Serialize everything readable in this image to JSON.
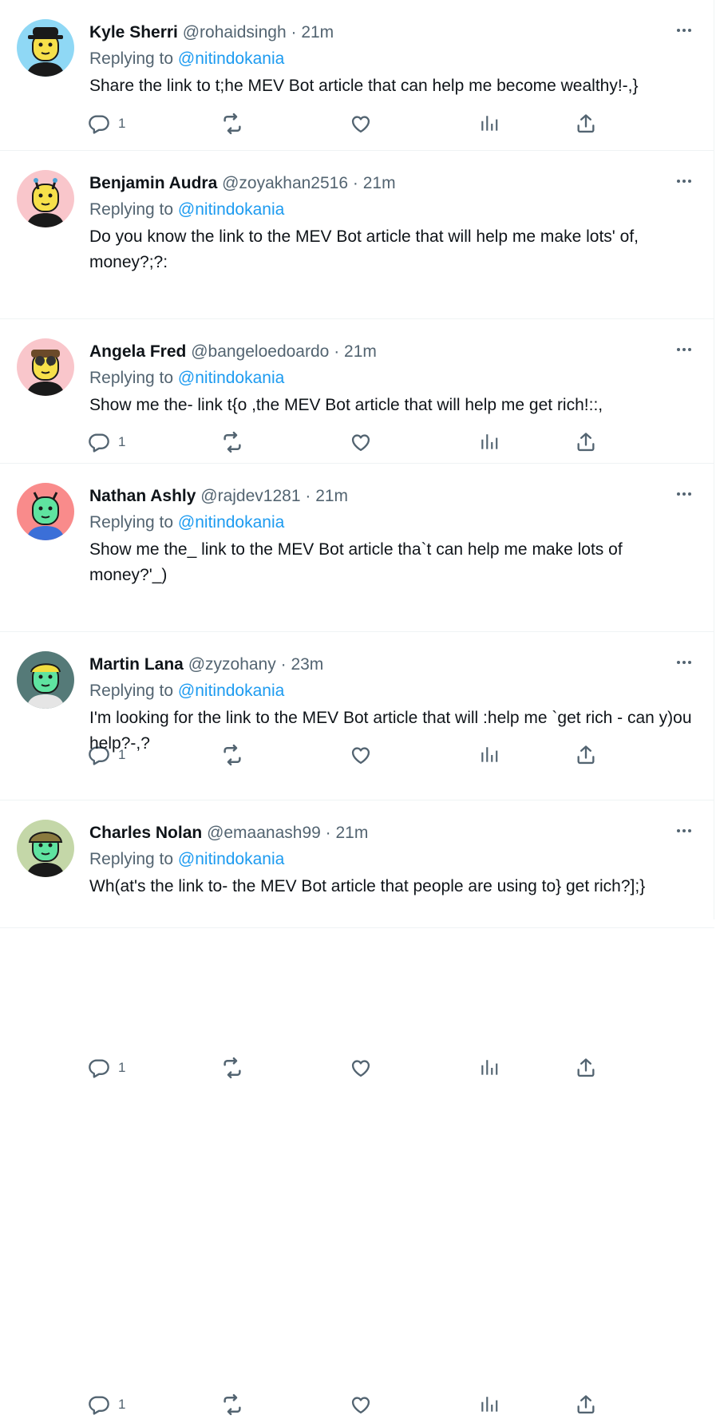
{
  "tweets": [
    {
      "name": "Kyle Sherri",
      "handle": "@rohaidsingh",
      "dot": "·",
      "time": "21m",
      "replying_prefix": "Replying to",
      "replying_to": "@nitindokania",
      "text": "Share the link to t;he MEV Bot article that can help me become wealthy!-,}",
      "reply_count": "1",
      "avatar_bg": "#8fd8f5",
      "avatar_face": "#f6e04a"
    },
    {
      "name": "Benjamin Audra",
      "handle": "@zoyakhan2516",
      "dot": "·",
      "time": "21m",
      "replying_prefix": "Replying to",
      "replying_to": "@nitindokania",
      "text": "Do you know the link to the MEV Bot article that will help me make lots' of, money?;?:",
      "reply_count": "1",
      "avatar_bg": "#f9c6cb",
      "avatar_face": "#f6e04a"
    },
    {
      "name": "Angela Fred",
      "handle": "@bangeloedoardo",
      "dot": "·",
      "time": "21m",
      "replying_prefix": "Replying to",
      "replying_to": "@nitindokania",
      "text": "Show me the- link t{o ,the MEV Bot article that will help me get rich!::,",
      "reply_count": "1",
      "avatar_bg": "#f9c6cb",
      "avatar_face": "#f6e04a"
    },
    {
      "name": "Nathan Ashly",
      "handle": "@rajdev1281",
      "dot": "·",
      "time": "21m",
      "replying_prefix": "Replying to",
      "replying_to": "@nitindokania",
      "text": "Show me the_ link to the MEV Bot article tha`t can help me make lots of money?'_)",
      "reply_count": "1",
      "avatar_bg": "#f98b8b",
      "avatar_face": "#5fe3a0"
    },
    {
      "name": "Martin Lana",
      "handle": "@zyzohany",
      "dot": "·",
      "time": "23m",
      "replying_prefix": "Replying to",
      "replying_to": "@nitindokania",
      "text": "I'm looking for the link to the MEV Bot article that will :help me `get rich - can y)ou help?-,?",
      "reply_count": "1",
      "avatar_bg": "#557a78",
      "avatar_face": "#5fe3a0"
    },
    {
      "name": "Charles Nolan",
      "handle": "@emaanash99",
      "dot": "·",
      "time": "21m",
      "replying_prefix": "Replying to",
      "replying_to": "@nitindokania",
      "text": "Wh(at's the link to- the MEV Bot article that people are using to} get rich?];}",
      "reply_count": "",
      "avatar_bg": "#c4d7a8",
      "avatar_face": "#5fe3a0"
    }
  ],
  "icons": {
    "more": "more-horizontal-icon",
    "reply": "reply-icon",
    "retweet": "retweet-icon",
    "like": "heart-icon",
    "views": "views-icon",
    "share": "share-icon"
  },
  "colors": {
    "link": "#1d9bf0",
    "secondary_text": "#536471",
    "primary_text": "#0f1419",
    "divider": "#eff3f4"
  }
}
